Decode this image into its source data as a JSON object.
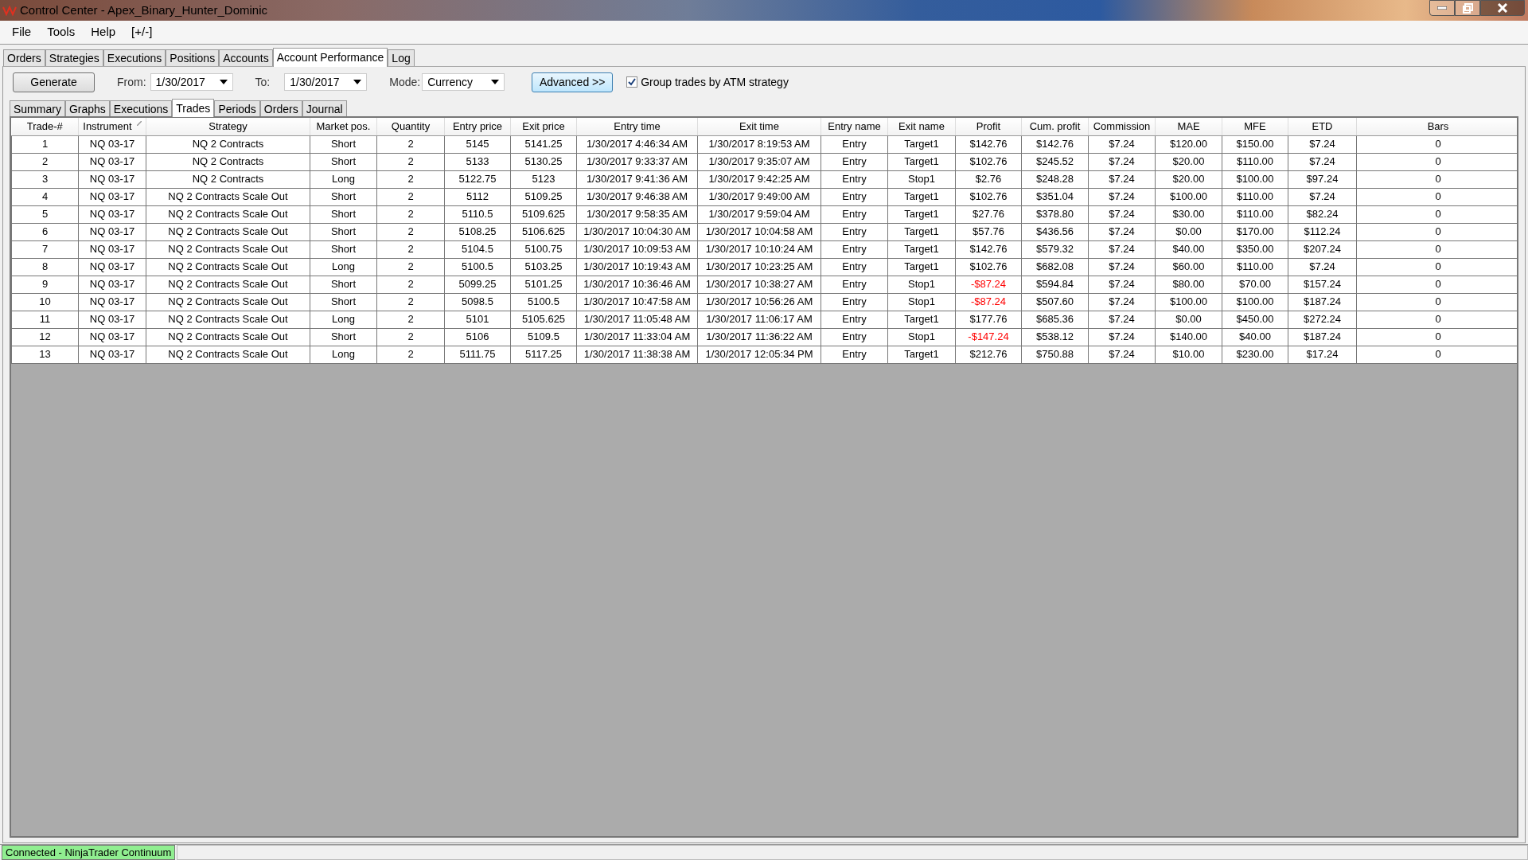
{
  "window": {
    "title": "Control Center - Apex_Binary_Hunter_Dominic"
  },
  "menu": [
    "File",
    "Tools",
    "Help",
    "[+/-]"
  ],
  "tabs": [
    {
      "label": "Orders",
      "selected": false
    },
    {
      "label": "Strategies",
      "selected": false
    },
    {
      "label": "Executions",
      "selected": false
    },
    {
      "label": "Positions",
      "selected": false
    },
    {
      "label": "Accounts",
      "selected": false
    },
    {
      "label": "Account Performance",
      "selected": true
    },
    {
      "label": "Log",
      "selected": false
    }
  ],
  "toolbar": {
    "generate": "Generate",
    "from_label": "From:",
    "from_value": "1/30/2017",
    "to_label": "To:",
    "to_value": "1/30/2017",
    "mode_label": "Mode:",
    "mode_value": "Currency",
    "advanced": "Advanced >>",
    "group_checkbox": {
      "label": "Group trades by ATM strategy",
      "checked": true
    }
  },
  "subtabs": [
    {
      "label": "Summary",
      "selected": false
    },
    {
      "label": "Graphs",
      "selected": false
    },
    {
      "label": "Executions",
      "selected": false
    },
    {
      "label": "Trades",
      "selected": true
    },
    {
      "label": "Periods",
      "selected": false
    },
    {
      "label": "Orders",
      "selected": false
    },
    {
      "label": "Journal",
      "selected": false
    }
  ],
  "table": {
    "columns": [
      {
        "label": "Trade-#",
        "sorted": false
      },
      {
        "label": "Instrument",
        "sorted": true
      },
      {
        "label": "Strategy",
        "sorted": false
      },
      {
        "label": "Market pos.",
        "sorted": false
      },
      {
        "label": "Quantity",
        "sorted": false
      },
      {
        "label": "Entry price",
        "sorted": false
      },
      {
        "label": "Exit price",
        "sorted": false
      },
      {
        "label": "Entry time",
        "sorted": false
      },
      {
        "label": "Exit time",
        "sorted": false
      },
      {
        "label": "Entry name",
        "sorted": false
      },
      {
        "label": "Exit name",
        "sorted": false
      },
      {
        "label": "Profit",
        "sorted": false
      },
      {
        "label": "Cum. profit",
        "sorted": false
      },
      {
        "label": "Commission",
        "sorted": false
      },
      {
        "label": "MAE",
        "sorted": false
      },
      {
        "label": "MFE",
        "sorted": false
      },
      {
        "label": "ETD",
        "sorted": false
      },
      {
        "label": "Bars",
        "sorted": false
      }
    ],
    "rows": [
      {
        "loss": false,
        "cells": [
          "1",
          "NQ 03-17",
          "NQ 2 Contracts",
          "Short",
          "2",
          "5145",
          "5141.25",
          "1/30/2017 4:46:34 AM",
          "1/30/2017 8:19:53 AM",
          "Entry",
          "Target1",
          "$142.76",
          "$142.76",
          "$7.24",
          "$120.00",
          "$150.00",
          "$7.24",
          "0"
        ]
      },
      {
        "loss": false,
        "cells": [
          "2",
          "NQ 03-17",
          "NQ 2 Contracts",
          "Short",
          "2",
          "5133",
          "5130.25",
          "1/30/2017 9:33:37 AM",
          "1/30/2017 9:35:07 AM",
          "Entry",
          "Target1",
          "$102.76",
          "$245.52",
          "$7.24",
          "$20.00",
          "$110.00",
          "$7.24",
          "0"
        ]
      },
      {
        "loss": false,
        "cells": [
          "3",
          "NQ 03-17",
          "NQ 2 Contracts",
          "Long",
          "2",
          "5122.75",
          "5123",
          "1/30/2017 9:41:36 AM",
          "1/30/2017 9:42:25 AM",
          "Entry",
          "Stop1",
          "$2.76",
          "$248.28",
          "$7.24",
          "$20.00",
          "$100.00",
          "$97.24",
          "0"
        ]
      },
      {
        "loss": false,
        "cells": [
          "4",
          "NQ 03-17",
          "NQ 2 Contracts Scale Out",
          "Short",
          "2",
          "5112",
          "5109.25",
          "1/30/2017 9:46:38 AM",
          "1/30/2017 9:49:00 AM",
          "Entry",
          "Target1",
          "$102.76",
          "$351.04",
          "$7.24",
          "$100.00",
          "$110.00",
          "$7.24",
          "0"
        ]
      },
      {
        "loss": false,
        "cells": [
          "5",
          "NQ 03-17",
          "NQ 2 Contracts Scale Out",
          "Short",
          "2",
          "5110.5",
          "5109.625",
          "1/30/2017 9:58:35 AM",
          "1/30/2017 9:59:04 AM",
          "Entry",
          "Target1",
          "$27.76",
          "$378.80",
          "$7.24",
          "$30.00",
          "$110.00",
          "$82.24",
          "0"
        ]
      },
      {
        "loss": false,
        "cells": [
          "6",
          "NQ 03-17",
          "NQ 2 Contracts Scale Out",
          "Short",
          "2",
          "5108.25",
          "5106.625",
          "1/30/2017 10:04:30 AM",
          "1/30/2017 10:04:58 AM",
          "Entry",
          "Target1",
          "$57.76",
          "$436.56",
          "$7.24",
          "$0.00",
          "$170.00",
          "$112.24",
          "0"
        ]
      },
      {
        "loss": false,
        "cells": [
          "7",
          "NQ 03-17",
          "NQ 2 Contracts Scale Out",
          "Short",
          "2",
          "5104.5",
          "5100.75",
          "1/30/2017 10:09:53 AM",
          "1/30/2017 10:10:24 AM",
          "Entry",
          "Target1",
          "$142.76",
          "$579.32",
          "$7.24",
          "$40.00",
          "$350.00",
          "$207.24",
          "0"
        ]
      },
      {
        "loss": false,
        "cells": [
          "8",
          "NQ 03-17",
          "NQ 2 Contracts Scale Out",
          "Long",
          "2",
          "5100.5",
          "5103.25",
          "1/30/2017 10:19:43 AM",
          "1/30/2017 10:23:25 AM",
          "Entry",
          "Target1",
          "$102.76",
          "$682.08",
          "$7.24",
          "$60.00",
          "$110.00",
          "$7.24",
          "0"
        ]
      },
      {
        "loss": true,
        "cells": [
          "9",
          "NQ 03-17",
          "NQ 2 Contracts Scale Out",
          "Short",
          "2",
          "5099.25",
          "5101.25",
          "1/30/2017 10:36:46 AM",
          "1/30/2017 10:38:27 AM",
          "Entry",
          "Stop1",
          "-$87.24",
          "$594.84",
          "$7.24",
          "$80.00",
          "$70.00",
          "$157.24",
          "0"
        ]
      },
      {
        "loss": true,
        "cells": [
          "10",
          "NQ 03-17",
          "NQ 2 Contracts Scale Out",
          "Short",
          "2",
          "5098.5",
          "5100.5",
          "1/30/2017 10:47:58 AM",
          "1/30/2017 10:56:26 AM",
          "Entry",
          "Stop1",
          "-$87.24",
          "$507.60",
          "$7.24",
          "$100.00",
          "$100.00",
          "$187.24",
          "0"
        ]
      },
      {
        "loss": false,
        "cells": [
          "11",
          "NQ 03-17",
          "NQ 2 Contracts Scale Out",
          "Long",
          "2",
          "5101",
          "5105.625",
          "1/30/2017 11:05:48 AM",
          "1/30/2017 11:06:17 AM",
          "Entry",
          "Target1",
          "$177.76",
          "$685.36",
          "$7.24",
          "$0.00",
          "$450.00",
          "$272.24",
          "0"
        ]
      },
      {
        "loss": true,
        "cells": [
          "12",
          "NQ 03-17",
          "NQ 2 Contracts Scale Out",
          "Short",
          "2",
          "5106",
          "5109.5",
          "1/30/2017 11:33:04 AM",
          "1/30/2017 11:36:22 AM",
          "Entry",
          "Stop1",
          "-$147.24",
          "$538.12",
          "$7.24",
          "$140.00",
          "$40.00",
          "$187.24",
          "0"
        ]
      },
      {
        "loss": false,
        "cells": [
          "13",
          "NQ 03-17",
          "NQ 2 Contracts Scale Out",
          "Long",
          "2",
          "5111.75",
          "5117.25",
          "1/30/2017 11:38:38 AM",
          "1/30/2017 12:05:34 PM",
          "Entry",
          "Target1",
          "$212.76",
          "$750.88",
          "$7.24",
          "$10.00",
          "$230.00",
          "$17.24",
          "0"
        ]
      }
    ]
  },
  "status_bar": {
    "connection": "Connected - NinjaTrader Continuum"
  }
}
